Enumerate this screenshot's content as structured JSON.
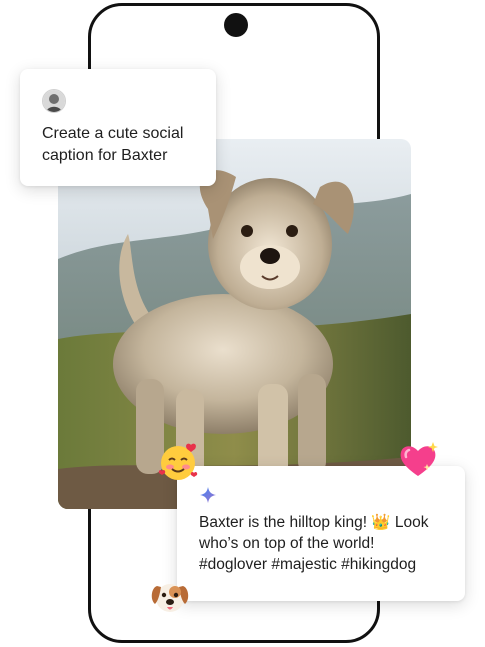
{
  "prompt_card": {
    "text": "Create a cute social caption for Baxter",
    "avatar_icon": "user-avatar-icon"
  },
  "reply_card": {
    "text": "Baxter is the hilltop king! 👑 Look who’s on top of the world! #doglover #majestic #hikingdog",
    "sparkle_icon": "gemini-sparkle-icon"
  },
  "emojis": {
    "smiling_face_with_hearts": "smiling-hearts-emoji",
    "sparkling_heart": "sparkling-heart-emoji",
    "dog_face": "dog-face-emoji"
  },
  "colors": {
    "phone_frame": "#111111",
    "card_background": "#ffffff",
    "text": "#1f1f1f",
    "sparkle_blue": "#4285f4"
  }
}
